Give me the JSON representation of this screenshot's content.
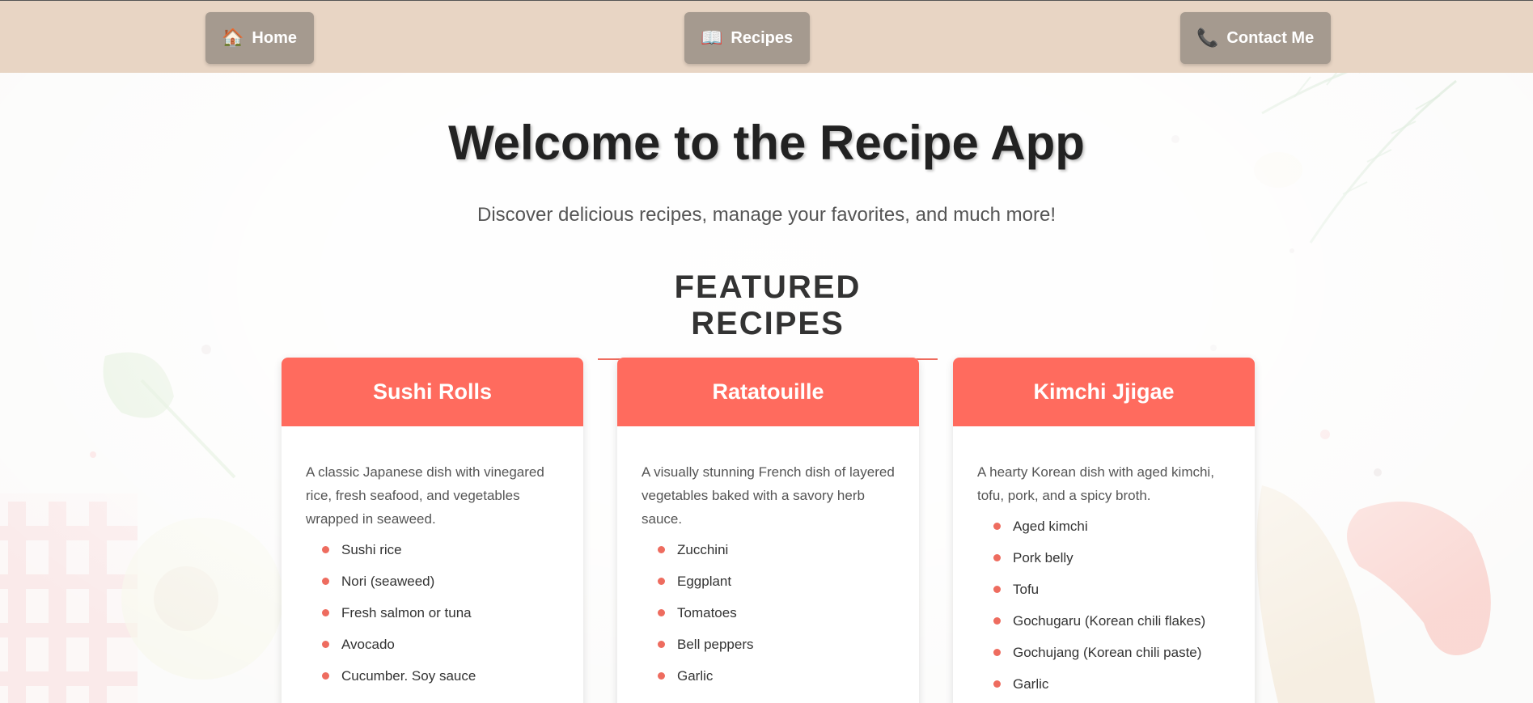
{
  "nav": {
    "home": {
      "icon": "house-icon",
      "glyph": "🏠",
      "label": "Home"
    },
    "recipes": {
      "icon": "open-book-icon",
      "glyph": "📖",
      "label": "Recipes"
    },
    "contact": {
      "icon": "telephone-icon",
      "glyph": "📞",
      "label": "Contact Me"
    }
  },
  "hero": {
    "title": "Welcome to the Recipe App",
    "subtitle": "Discover delicious recipes, manage your favorites, and much more!"
  },
  "featured": {
    "heading": "FEATURED RECIPES",
    "recipes": [
      {
        "name": "Sushi Rolls",
        "description": "A classic Japanese dish with vinegared rice, fresh seafood, and vegetables wrapped in seaweed.",
        "ingredients": [
          "Sushi rice",
          "Nori (seaweed)",
          "Fresh salmon or tuna",
          "Avocado",
          "Cucumber. Soy sauce"
        ]
      },
      {
        "name": "Ratatouille",
        "description": "A visually stunning French dish of layered vegetables baked with a savory herb sauce.",
        "ingredients": [
          "Zucchini",
          "Eggplant",
          "Tomatoes",
          "Bell peppers",
          "Garlic"
        ]
      },
      {
        "name": "Kimchi Jjigae",
        "description": "A hearty Korean dish with aged kimchi, tofu, pork, and a spicy broth.",
        "ingredients": [
          "Aged kimchi",
          "Pork belly",
          "Tofu",
          "Gochugaru (Korean chili flakes)",
          "Gochujang (Korean chili paste)",
          "Garlic"
        ]
      }
    ]
  },
  "colors": {
    "nav_bg": "#e8d5c4",
    "nav_button": "#a59a8f",
    "card_header": "#ff6b5e",
    "accent": "#ee6c5f"
  }
}
